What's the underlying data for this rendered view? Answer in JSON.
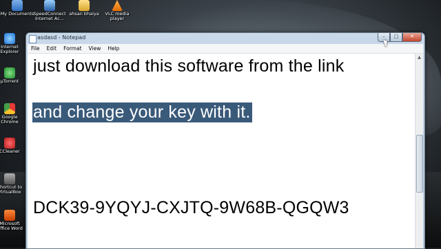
{
  "desktop": {
    "top_icons": [
      {
        "label": "My Documents",
        "icon": "documents-icon"
      },
      {
        "label": "SpeedConnect Internet Ac...",
        "icon": "network-icon"
      },
      {
        "label": "ahsan bhaiya",
        "icon": "folder-icon"
      },
      {
        "label": "VLC media player",
        "icon": "vlc-icon"
      }
    ],
    "side_icons": [
      {
        "label": "Internet Explorer",
        "icon": "ie-icon"
      },
      {
        "label": "µTorrent",
        "icon": "utorrent-icon"
      },
      {
        "label": "Google Chrome",
        "icon": "chrome-icon"
      },
      {
        "label": "CCleaner",
        "icon": "ccleaner-icon"
      },
      {
        "label": "Shortcut to VirtualBox",
        "icon": "virtualbox-icon"
      },
      {
        "label": "Microsoft Office Word",
        "icon": "word-icon"
      }
    ]
  },
  "window": {
    "title": "asdasd - Notepad",
    "buttons": {
      "minimize": "–",
      "maximize": "□",
      "close": "✕"
    },
    "menu": [
      "File",
      "Edit",
      "Format",
      "View",
      "Help"
    ],
    "lines": [
      {
        "text": "just download this software from the link",
        "selected": false
      },
      {
        "text": "and change your key with it.",
        "selected": true
      },
      {
        "text": "DCK39-9YQYJ-CXJTQ-9W68B-QGQW3",
        "selected": false
      }
    ]
  },
  "colors": {
    "selection": "#3a5a7a",
    "titlebar": "#c9d9ea"
  }
}
